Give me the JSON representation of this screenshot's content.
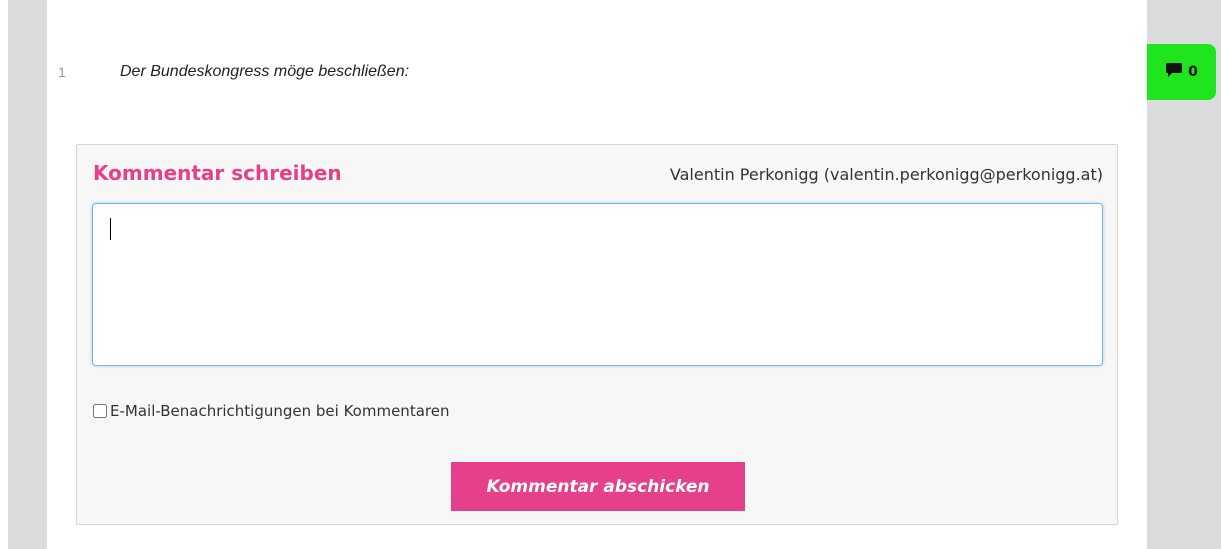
{
  "colors": {
    "accent": "#e6408a",
    "comment_indicator": "#1ee51e",
    "sidebar": "#dcdcdc",
    "panel_background": "#f7f7f7"
  },
  "motion": {
    "line_number": "1",
    "text": "Der Bundeskongress möge beschließen:"
  },
  "comment_indicator": {
    "icon": "comment-icon",
    "count": "0"
  },
  "comment_form": {
    "title": "Kommentar schreiben",
    "user": "Valentin Perkonigg (valentin.perkonigg@perkonigg.at)",
    "textarea_value": "",
    "notify_label": "E-Mail-Benachrichtigungen bei Kommentaren",
    "notify_checked": false,
    "submit_label": "Kommentar abschicken"
  }
}
